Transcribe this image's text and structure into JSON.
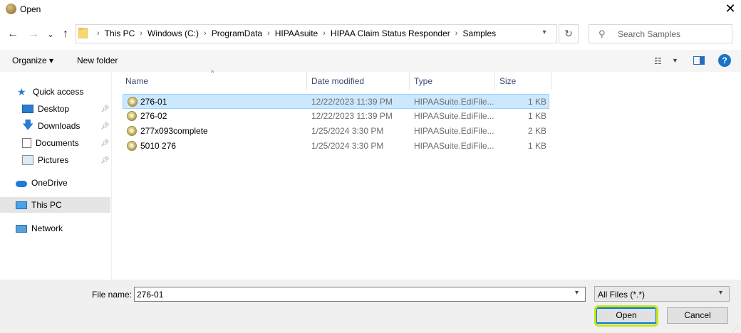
{
  "window": {
    "title": "Open",
    "close_glyph": "✕"
  },
  "nav": {
    "back_glyph": "←",
    "forward_glyph": "→",
    "recent_glyph": "⌄",
    "up_glyph": "↑",
    "breadcrumbs": [
      "This PC",
      "Windows (C:)",
      "ProgramData",
      "HIPAAsuite",
      "HIPAA Claim Status Responder",
      "Samples"
    ],
    "refresh_glyph": "↻",
    "search_placeholder": "Search Samples"
  },
  "toolbar": {
    "organize": "Organize ▾",
    "new_folder": "New folder"
  },
  "sidebar": {
    "items": [
      {
        "label": "Quick access",
        "icon": "star-icon"
      },
      {
        "label": "Desktop",
        "icon": "desktop-icon",
        "pinned": true
      },
      {
        "label": "Downloads",
        "icon": "download-icon",
        "pinned": true
      },
      {
        "label": "Documents",
        "icon": "documents-icon",
        "pinned": true
      },
      {
        "label": "Pictures",
        "icon": "pictures-icon",
        "pinned": true
      },
      {
        "label": "OneDrive",
        "icon": "cloud-icon"
      },
      {
        "label": "This PC",
        "icon": "computer-icon",
        "selected": true
      },
      {
        "label": "Network",
        "icon": "network-icon"
      }
    ]
  },
  "columns": {
    "name": "Name",
    "date": "Date modified",
    "type": "Type",
    "size": "Size"
  },
  "files": [
    {
      "name": "276-01",
      "date": "12/22/2023 11:39 PM",
      "type": "HIPAASuite.EdiFile...",
      "size": "1 KB",
      "selected": true
    },
    {
      "name": "276-02",
      "date": "12/22/2023 11:39 PM",
      "type": "HIPAASuite.EdiFile...",
      "size": "1 KB"
    },
    {
      "name": "277x093complete",
      "date": "1/25/2024 3:30 PM",
      "type": "HIPAASuite.EdiFile...",
      "size": "2 KB"
    },
    {
      "name": "5010 276",
      "date": "1/25/2024 3:30 PM",
      "type": "HIPAASuite.EdiFile...",
      "size": "1 KB"
    }
  ],
  "footer": {
    "file_name_label": "File name:",
    "file_name_value": "276-01",
    "filter_value": "All Files (*.*)",
    "open_label": "Open",
    "cancel_label": "Cancel"
  },
  "colors": {
    "selection": "#cce8ff",
    "highlight": "#c4e61e",
    "accent": "#0078d7"
  }
}
